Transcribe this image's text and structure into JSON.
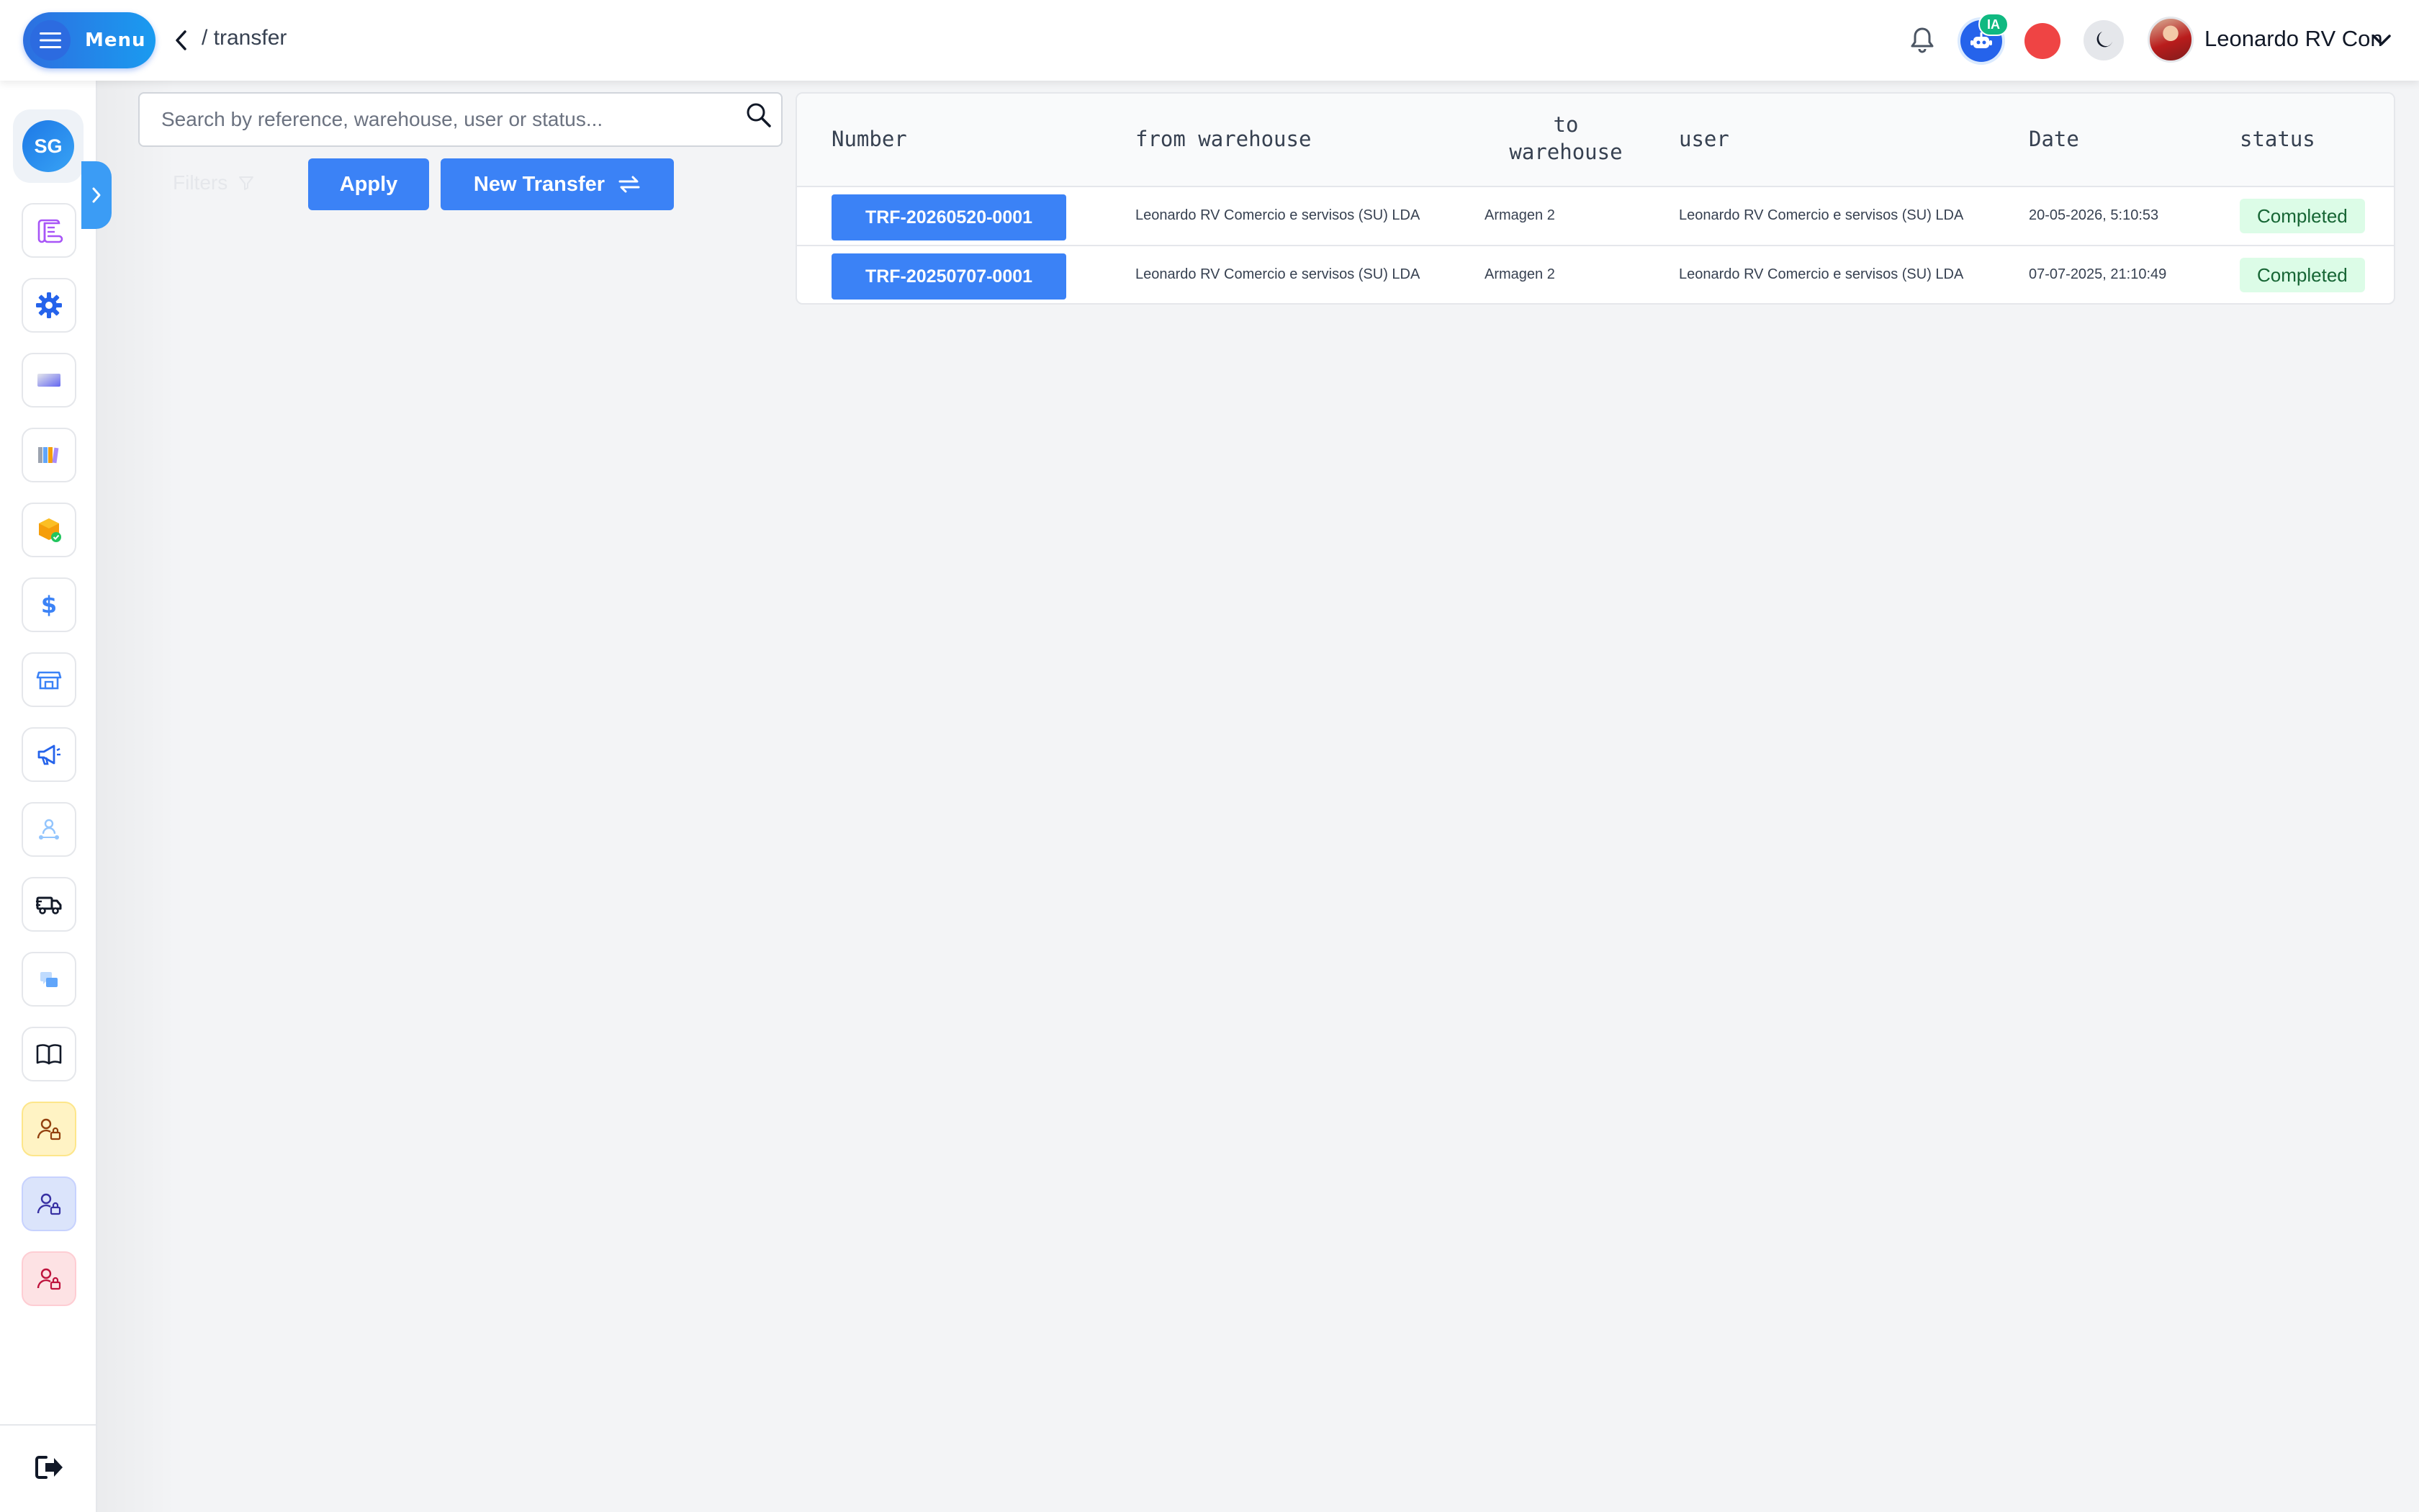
{
  "header": {
    "menu_label": "Menu",
    "breadcrumb": "/ transfer",
    "ia_badge": "IA",
    "user_name": "Leonardo RV Con"
  },
  "sidebar": {
    "brand_initials": "SG",
    "items": [
      {
        "icon": "scroll-icon"
      },
      {
        "icon": "gear-icon"
      },
      {
        "icon": "gradient-card-icon"
      },
      {
        "icon": "books-icon"
      },
      {
        "icon": "box-check-icon"
      },
      {
        "icon": "dollar-icon"
      },
      {
        "icon": "store-icon"
      },
      {
        "icon": "megaphone-icon"
      },
      {
        "icon": "user-network-icon"
      },
      {
        "icon": "truck-icon"
      },
      {
        "icon": "delivery-chat-icon"
      },
      {
        "icon": "book-open-icon"
      },
      {
        "icon": "user-lock-icon"
      },
      {
        "icon": "user-lock-icon"
      },
      {
        "icon": "user-lock-icon"
      }
    ]
  },
  "controls": {
    "search_placeholder": "Search by reference, warehouse, user or status...",
    "filters_label": "Filters",
    "apply_label": "Apply",
    "new_transfer_label": "New Transfer"
  },
  "table": {
    "columns": {
      "number": "Number",
      "from_warehouse": "from warehouse",
      "to_warehouse_1": "to",
      "to_warehouse_2": "warehouse",
      "user": "user",
      "date": "Date",
      "status": "status"
    },
    "rows": [
      {
        "number": "TRF-20260520-0001",
        "from_warehouse": "Leonardo RV Comercio e servisos (SU) LDA",
        "to_warehouse": "Armagen 2",
        "user": "Leonardo RV Comercio e servisos (SU) LDA",
        "date": "20-05-2026, 5:10:53",
        "status": "Completed"
      },
      {
        "number": "TRF-20250707-0001",
        "from_warehouse": "Leonardo RV Comercio e servisos (SU) LDA",
        "to_warehouse": "Armagen 2",
        "user": "Leonardo RV Comercio e servisos (SU) LDA",
        "date": "07-07-2025, 21:10:49",
        "status": "Completed"
      }
    ]
  },
  "colors": {
    "primary": "#3b82f6",
    "status_completed_bg": "#dcfce7",
    "status_completed_text": "#166534",
    "record": "#ef4444"
  }
}
